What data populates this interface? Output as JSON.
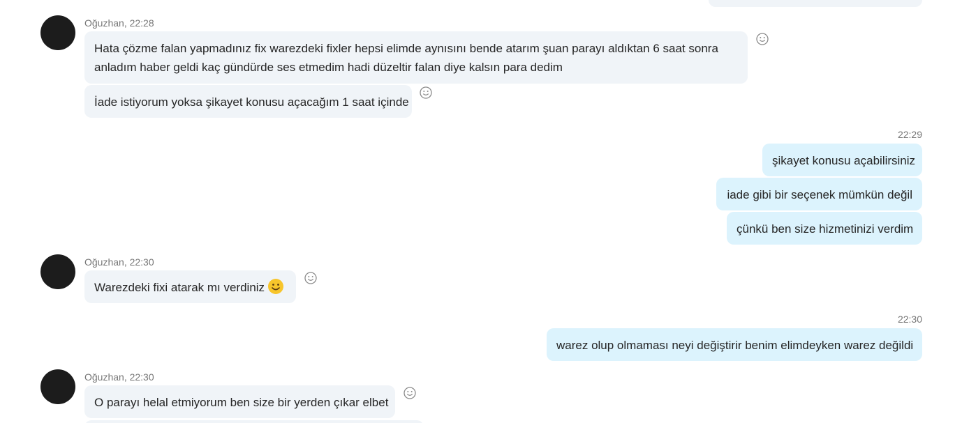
{
  "colors": {
    "incoming_bubble": "#f0f4f8",
    "outgoing_bubble": "#dcf3fd",
    "avatar": "#1c1c1c",
    "meta_text": "#767676",
    "emoji_yellow": "#f7c52b"
  },
  "icons": {
    "reaction": "smiley-outline-icon",
    "inline_emoji": "smiley-emoji-icon"
  },
  "messages": [
    {
      "sender_meta": "Oğuzhan, 22:28",
      "lines": [
        "Hata çözme falan yapmadınız fix warezdeki fixler hepsi elimde aynısını bende atarım şuan parayı aldıktan 6 saat sonra",
        "anladım haber geldi kaç gündürde ses etmedim hadi düzeltir falan diye kalsın para dedim"
      ],
      "second": "İade istiyorum yoksa şikayet konusu açacağım 1 saat içinde"
    },
    {
      "time": "22:29",
      "items": [
        "şikayet konusu açabilirsiniz",
        "iade gibi bir seçenek mümkün değil",
        "çünkü ben size hizmetinizi verdim"
      ]
    },
    {
      "sender_meta": "Oğuzhan, 22:30",
      "text": "Warezdeki fixi atarak mı verdiniz"
    },
    {
      "time": "22:30",
      "text": "warez olup olmaması neyi değiştirir benim elimdeyken warez değildi"
    },
    {
      "sender_meta": "Oğuzhan, 22:30",
      "text": "O parayı helal etmiyorum ben size bir yerden çıkar elbet"
    }
  ]
}
